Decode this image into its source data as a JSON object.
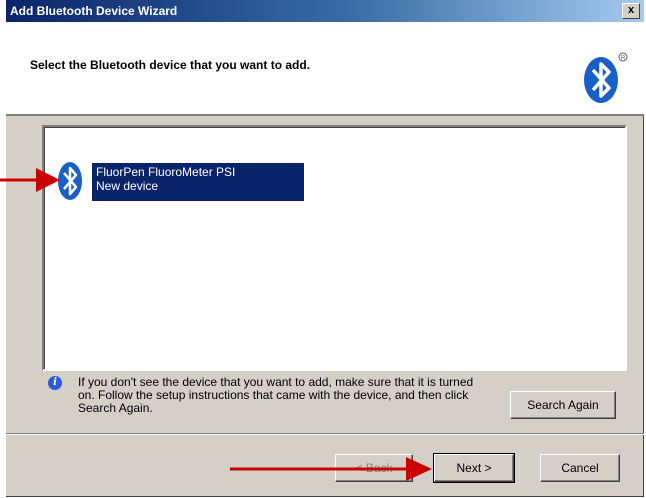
{
  "window": {
    "title": "Add Bluetooth Device Wizard",
    "close_label": "x"
  },
  "header": {
    "title": "Select the Bluetooth device that you want to add.",
    "logo_icon": "bluetooth-logo-icon"
  },
  "device_list": {
    "items": [
      {
        "name": "FluorPen FluoroMeter PSI",
        "status": "New device",
        "icon": "bluetooth-device-icon",
        "selected": true
      }
    ]
  },
  "info": {
    "icon": "info-icon",
    "text": "If you don't see the device that you want to add, make sure that it is turned on. Follow the setup instructions that came with the device, and then click Search Again."
  },
  "buttons": {
    "search_again": "Search Again",
    "back": "< Back",
    "next": "Next >",
    "cancel": "Cancel"
  },
  "colors": {
    "title_bar": "#0a246a",
    "selection": "#0a246a",
    "arrow": "#cc0000",
    "bluetooth": "#1a5fc4"
  }
}
